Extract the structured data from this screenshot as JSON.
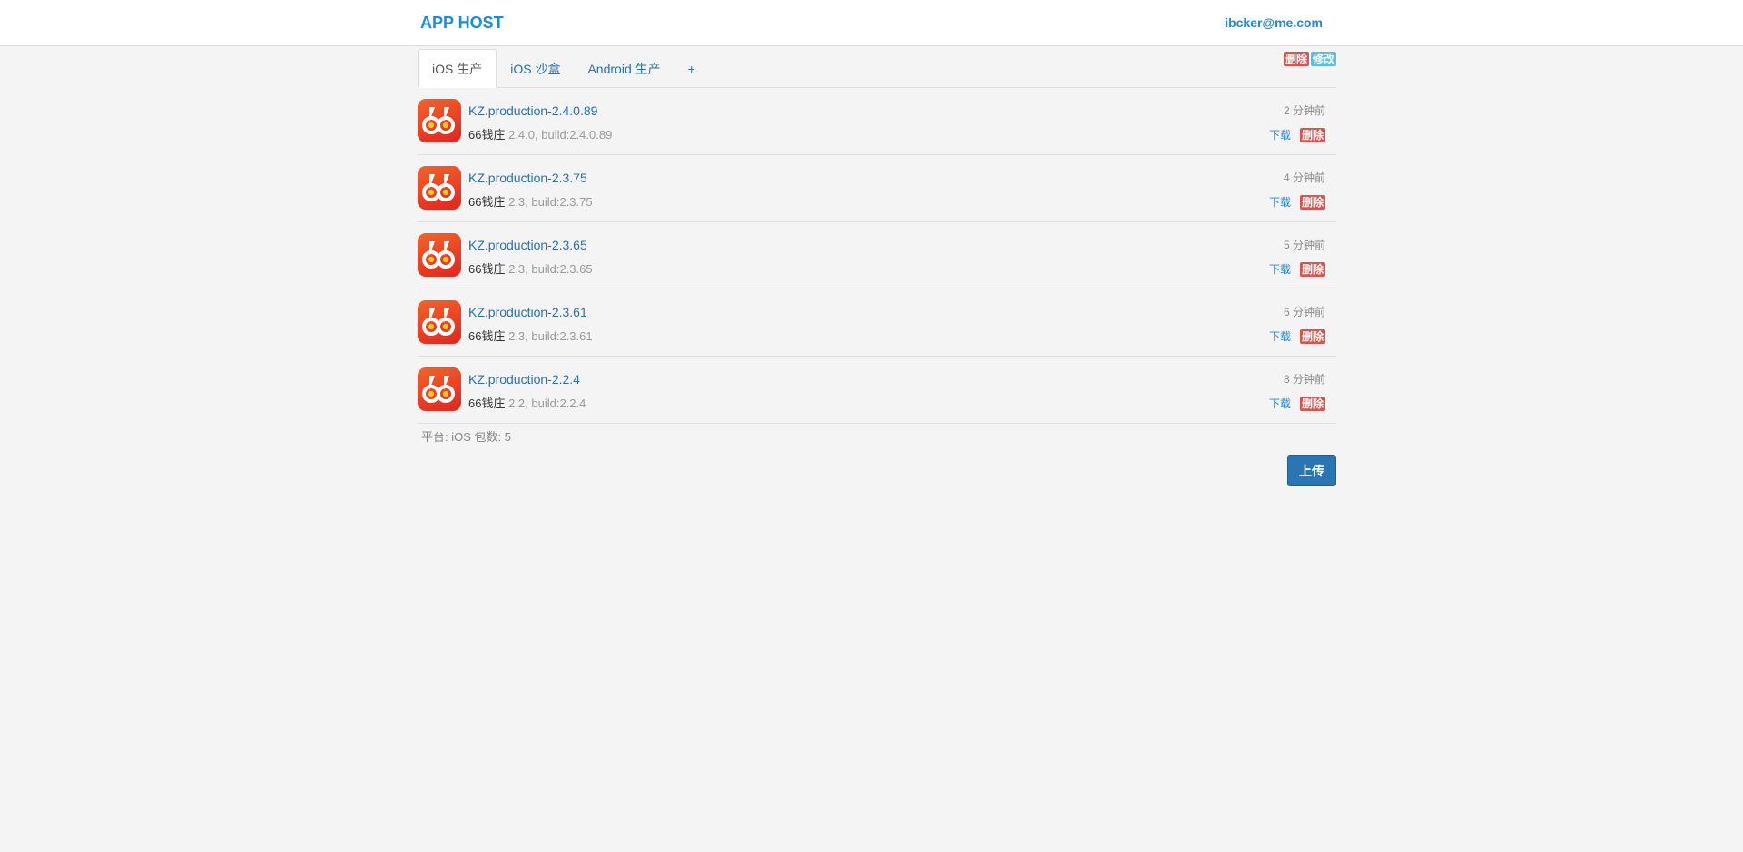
{
  "header": {
    "brand": "APP HOST",
    "user_email": "ibcker@me.com"
  },
  "tabs": [
    {
      "label": "iOS 生产",
      "active": true
    },
    {
      "label": "iOS 沙盒",
      "active": false
    },
    {
      "label": "Android 生产",
      "active": false
    },
    {
      "label": "+",
      "active": false
    }
  ],
  "group_actions": {
    "delete_label": "删除",
    "edit_label": "修改"
  },
  "apps": [
    {
      "name": "KZ.production-2.4.0.89",
      "title": "66钱庄",
      "details": "2.4.0, build:2.4.0.89",
      "time": "2 分钟前",
      "download": "下载",
      "delete": "删除",
      "icon": "app-icon-66"
    },
    {
      "name": "KZ.production-2.3.75",
      "title": "66钱庄",
      "details": "2.3, build:2.3.75",
      "time": "4 分钟前",
      "download": "下载",
      "delete": "删除",
      "icon": "app-icon-66"
    },
    {
      "name": "KZ.production-2.3.65",
      "title": "66钱庄",
      "details": "2.3, build:2.3.65",
      "time": "5 分钟前",
      "download": "下载",
      "delete": "删除",
      "icon": "app-icon-66"
    },
    {
      "name": "KZ.production-2.3.61",
      "title": "66钱庄",
      "details": "2.3, build:2.3.61",
      "time": "6 分钟前",
      "download": "下载",
      "delete": "删除",
      "icon": "app-icon-66"
    },
    {
      "name": "KZ.production-2.2.4",
      "title": "66钱庄",
      "details": "2.2, build:2.2.4",
      "time": "8 分钟前",
      "download": "下载",
      "delete": "删除",
      "icon": "app-icon-66"
    }
  ],
  "footer": {
    "info": "平台: iOS 包数: 5",
    "upload_label": "上传"
  },
  "colors": {
    "accent": "#1a8be0",
    "link": "#2a6fb0",
    "danger": "#d9534f",
    "info": "#5bc0de",
    "primary_button": "#2a75b3",
    "background": "#f4f4f4"
  }
}
